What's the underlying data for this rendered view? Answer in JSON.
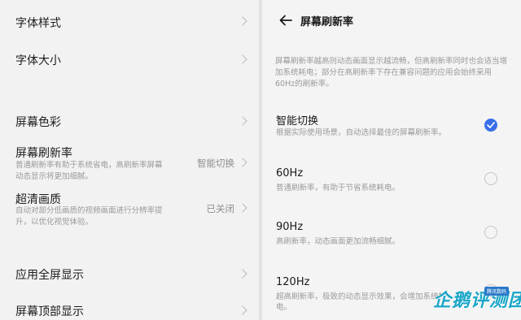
{
  "left": {
    "font_style": "字体样式",
    "font_size": "字体大小",
    "screen_color": "屏幕色彩",
    "refresh_rate": {
      "title": "屏幕刷新率",
      "subtitle": "普通刷新率有助于系统省电，高刷新率屏幕动态显示将更加细腻。",
      "value": "智能切换"
    },
    "hd_quality": {
      "title": "超清画质",
      "subtitle": "自动对部分低画质的视频画面进行分辨率提升，以优化视觉体验。",
      "value": "已关闭"
    },
    "app_fullscreen": "应用全屏显示",
    "screen_top": "屏幕顶部显示"
  },
  "right": {
    "title": "屏幕刷新率",
    "description": "屏幕刷新率越高则动态画面显示越流畅，但高刷新率同时也会适当增加系统耗电；部分在高刷新率下存在兼容问题的应用会始终采用60Hz的刷新率。",
    "options": [
      {
        "title": "智能切换",
        "subtitle": "根据实际使用场景，自动选择最佳的屏幕刷新率。",
        "selected": true
      },
      {
        "title": "60Hz",
        "subtitle": "普通刷新率，有助于节省系统耗电。",
        "selected": false
      },
      {
        "title": "90Hz",
        "subtitle": "高刷新率，动态画面更加流畅细腻。",
        "selected": false
      },
      {
        "title": "120Hz",
        "subtitle": "超高刷新率，极致的动态显示效果，会增加系统耗电。",
        "selected": false
      }
    ]
  },
  "watermark": {
    "text": "企鹅评测团",
    "tag": "腾讯数码"
  },
  "colors": {
    "accent": "#3a6ee8",
    "watermark": "#1aa6c8"
  },
  "icons": {
    "back": "back-arrow-icon",
    "chevron": "chevron-right-icon",
    "check": "check-icon"
  }
}
